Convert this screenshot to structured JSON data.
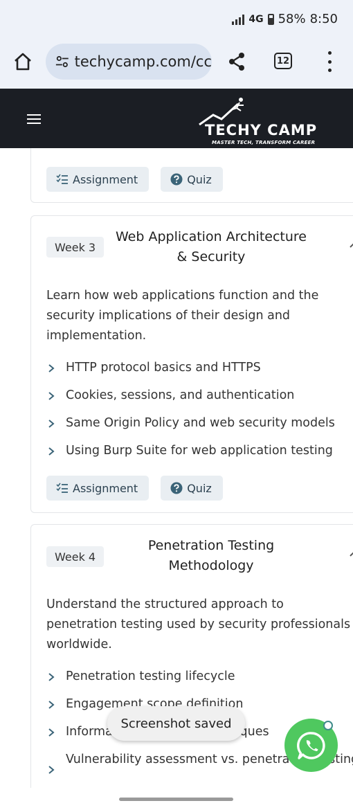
{
  "status_bar": {
    "network": "4G",
    "battery": "58%",
    "time": "8:50"
  },
  "browser": {
    "url": "techycamp.com/cc",
    "tab_count": "12"
  },
  "site": {
    "logo_title": "TECHY CAMP",
    "logo_tagline": "MASTER TECH, TRANSFORM CAREER"
  },
  "buttons": {
    "assignment": "Assignment",
    "quiz": "Quiz"
  },
  "weeks": [
    {
      "badge": "Week 3",
      "title_line1": "Web Application Architecture",
      "title_line2": "& Security",
      "description": "Learn how web applications function and the security implications of their design and implementation.",
      "topics": [
        "HTTP protocol basics and HTTPS",
        "Cookies, sessions, and authentication",
        "Same Origin Policy and web security models",
        "Using Burp Suite for web application testing"
      ]
    },
    {
      "badge": "Week 4",
      "title_line1": "Penetration Testing",
      "title_line2": "Methodology",
      "description": "Understand the structured approach to penetration testing used by security professionals worldwide.",
      "topics": [
        "Penetration testing lifecycle",
        "Engagement scope definition",
        "Information gathering techniques",
        "Vulnerability assessment vs. penetration testing"
      ]
    }
  ],
  "toast": "Screenshot saved",
  "colors": {
    "header_bg": "#1b1e24",
    "whatsapp": "#4fc85f",
    "chip_bg": "#e9eef2"
  }
}
